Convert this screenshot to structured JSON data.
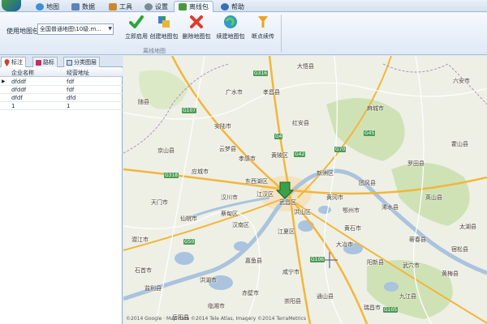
{
  "menu": {
    "tabs": [
      {
        "label": "地图",
        "icon": "globe-icon",
        "color": "#3d8fd6",
        "active": false
      },
      {
        "label": "数据",
        "icon": "table-icon",
        "color": "#5b84b8",
        "active": false
      },
      {
        "label": "工具",
        "icon": "tools-icon",
        "color": "#c98a2f",
        "active": false
      },
      {
        "label": "设置",
        "icon": "gear-icon",
        "color": "#7a8a9a",
        "active": false
      },
      {
        "label": "离线包",
        "icon": "package-icon",
        "color": "#4a9a3a",
        "active": true
      },
      {
        "label": "帮助",
        "icon": "help-icon",
        "color": "#3a6fb5",
        "active": false
      }
    ]
  },
  "ribbon": {
    "map_select_label": "使用地图包:",
    "map_select_value": "全国普通地图\\10级.m...",
    "buttons": [
      {
        "label": "立即启用",
        "icon": "check-icon",
        "color": "#2fa43a"
      },
      {
        "label": "创建地图包",
        "icon": "create-package-icon",
        "color": "#3b82d0"
      },
      {
        "label": "删除地图包",
        "icon": "delete-icon",
        "color": "#e03a2f"
      },
      {
        "label": "续建地图包",
        "icon": "continue-build-icon",
        "color": "#2e9ad0"
      },
      {
        "label": "断点续传",
        "icon": "resume-download-icon",
        "color": "#f0a020"
      }
    ],
    "group_caption": "离线地图"
  },
  "panel": {
    "tabs": [
      {
        "label": "标注",
        "icon": "pin-icon",
        "color": "#d64030",
        "active": true
      },
      {
        "label": "路标",
        "icon": "signpost-icon",
        "color": "#c03060",
        "active": false
      },
      {
        "label": "分类图层",
        "icon": "layers-icon",
        "color": "#4c6a8c",
        "active": false
      }
    ],
    "columns": [
      "企业名称",
      "经营地址"
    ],
    "rows": [
      [
        "dfddf",
        "fdf"
      ],
      [
        "dfddf",
        "fdf"
      ],
      [
        "dfdf",
        "dfd"
      ],
      [
        "1",
        "1"
      ]
    ],
    "selected_row": 0
  },
  "map": {
    "colors": {
      "land": "#eef0e6",
      "water": "#aac3de",
      "green": "#cfe2b6",
      "expressway": "#f2b63a",
      "road": "#ffffff",
      "urban": "#f3e3c0"
    },
    "place_labels": [
      {
        "text": "大悟县"
      },
      {
        "text": "孝昌县"
      },
      {
        "text": "广水市"
      },
      {
        "text": "安陆市"
      },
      {
        "text": "红安县"
      },
      {
        "text": "麻城市"
      },
      {
        "text": "应城市"
      },
      {
        "text": "云梦县"
      },
      {
        "text": "孝感市"
      },
      {
        "text": "黄陂区"
      },
      {
        "text": "新洲区"
      },
      {
        "text": "团风县"
      },
      {
        "text": "罗田县"
      },
      {
        "text": "汉川市"
      },
      {
        "text": "东西湖区"
      },
      {
        "text": "江汉区"
      },
      {
        "text": "武昌区"
      },
      {
        "text": "洪山区"
      },
      {
        "text": "汉南区"
      },
      {
        "text": "蔡甸区"
      },
      {
        "text": "江夏区"
      },
      {
        "text": "鄂州市"
      },
      {
        "text": "黄冈市"
      },
      {
        "text": "浠水县"
      },
      {
        "text": "黄石市"
      },
      {
        "text": "大冶市"
      },
      {
        "text": "咸宁市"
      },
      {
        "text": "嘉鱼县"
      },
      {
        "text": "洪湖市"
      },
      {
        "text": "仙桃市"
      },
      {
        "text": "天门市"
      },
      {
        "text": "京山县"
      },
      {
        "text": "潜江市"
      },
      {
        "text": "监利县"
      },
      {
        "text": "赤壁市"
      },
      {
        "text": "崇阳县"
      },
      {
        "text": "通山县"
      },
      {
        "text": "阳新县"
      },
      {
        "text": "武穴市"
      },
      {
        "text": "蕲春县"
      },
      {
        "text": "英山县"
      },
      {
        "text": "黄梅县"
      },
      {
        "text": "随县"
      },
      {
        "text": "九江县"
      },
      {
        "text": "瑞昌市"
      },
      {
        "text": "宿松县"
      },
      {
        "text": "太湖县"
      },
      {
        "text": "岳阳县"
      },
      {
        "text": "临湘市"
      },
      {
        "text": "石首市"
      },
      {
        "text": "六安市"
      },
      {
        "text": "霍山县"
      }
    ],
    "road_shields": [
      "G107",
      "G316",
      "G318",
      "G70",
      "G4",
      "G50",
      "G42",
      "G106",
      "G105",
      "G45"
    ],
    "marker": "map-marker-icon",
    "copyright": "©2014 Google · Map data ©2014 Tele Atlas, Imagery ©2014 TerraMetrics"
  }
}
